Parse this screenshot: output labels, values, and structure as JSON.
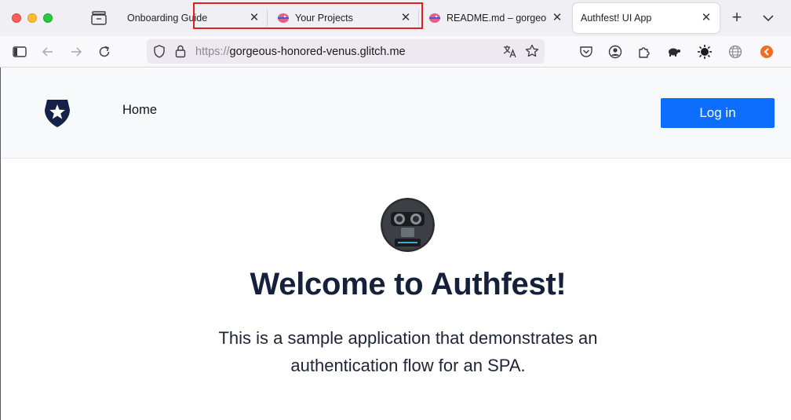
{
  "browser": {
    "tabs": [
      {
        "title": "Onboarding Guide",
        "active": false,
        "favicon": "none"
      },
      {
        "title": "Your Projects",
        "active": false,
        "favicon": "glitch-fish-icon"
      },
      {
        "title": "README.md – gorgeous-",
        "active": false,
        "favicon": "glitch-fish-icon"
      },
      {
        "title": "Authfest! UI App",
        "active": true,
        "favicon": "none"
      }
    ],
    "close_glyph": "✕",
    "new_tab_glyph": "+",
    "url_scheme": "https://",
    "url_host": "gorgeous-honored-venus.glitch.me",
    "highlight_color": "#e0201c"
  },
  "page": {
    "nav": {
      "home_label": "Home"
    },
    "login_label": "Log in",
    "hero": {
      "title": "Welcome to Authfest!",
      "description": "This is a sample application that demonstrates an authentication flow for an SPA."
    },
    "colors": {
      "primary": "#0d6efd",
      "title": "#15213a",
      "logo": "#16214a"
    }
  }
}
